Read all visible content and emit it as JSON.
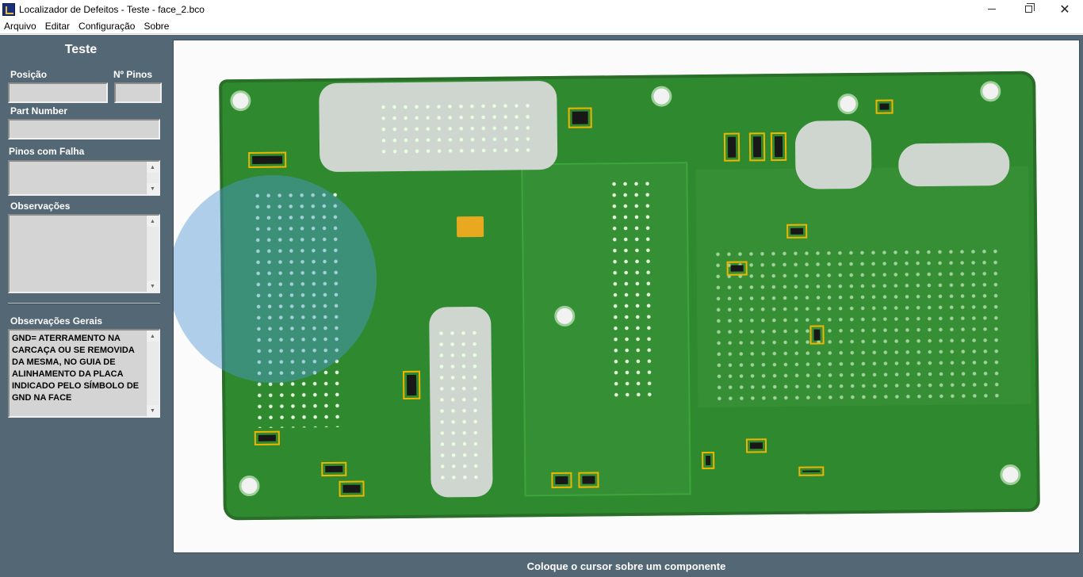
{
  "window": {
    "title": "Localizador de Defeitos - Teste - face_2.bco"
  },
  "menu": {
    "items": [
      "Arquivo",
      "Editar",
      "Configuração",
      "Sobre"
    ]
  },
  "panel": {
    "title": "Teste",
    "posicao_label": "Posição",
    "posicao_value": "",
    "npinos_label": "Nº Pinos",
    "npinos_value": "",
    "part_number_label": "Part Number",
    "part_number_value": "",
    "pinos_falha_label": "Pinos com Falha",
    "pinos_falha_value": "",
    "observacoes_label": "Observações",
    "observacoes_value": "",
    "obs_gerais_label": "Observações Gerais",
    "obs_gerais_value": "GND= ATERRAMENTO NA\nCARCAÇA OU SE REMOVIDA\nDA MESMA, NO GUIA DE\nALINHAMENTO DA PLACA\nINDICADO PELO SÍMBOLO DE\nGND NA FACE"
  },
  "status": {
    "text": "Coloque o cursor sobre um componente"
  },
  "colors": {
    "panel_bg": "#546775",
    "highlight": "#f0b400",
    "pcb_green": "#2f8a2f"
  },
  "icons": {
    "app": "app-icon",
    "minimize": "minimize-icon",
    "maximize": "restore-icon",
    "close": "close-icon"
  }
}
